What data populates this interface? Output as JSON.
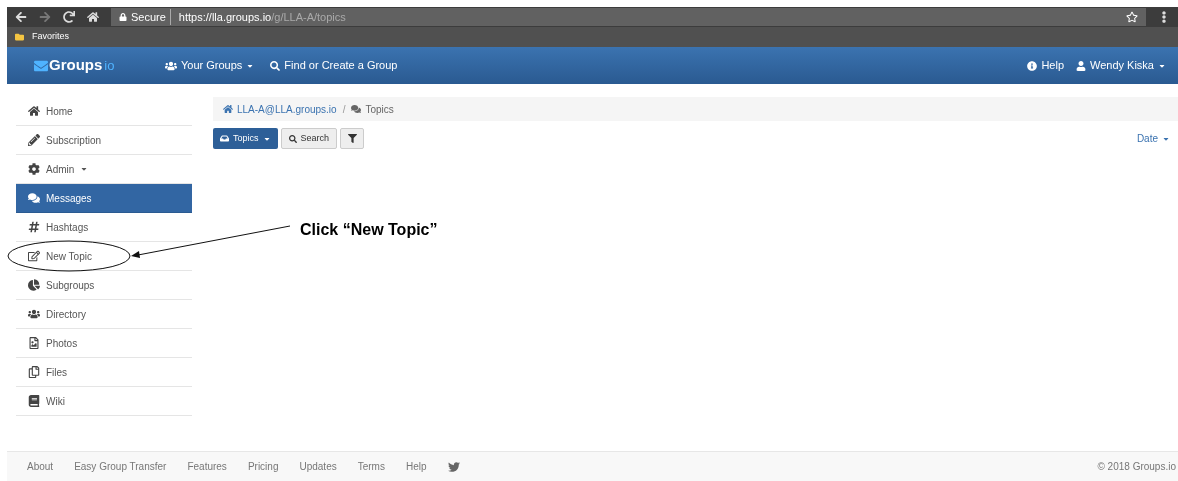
{
  "browser": {
    "secure_label": "Secure",
    "url_host": "https://lla.groups.io",
    "url_path": "/g/LLA-A/topics",
    "bookmarks": [
      "Favorites"
    ]
  },
  "navbar": {
    "logo": "Groups",
    "logo_suffix": "io",
    "left_items": [
      "Your Groups",
      "Find or Create a Group"
    ],
    "right_items": [
      "Help",
      "Wendy Kiska"
    ]
  },
  "sidebar": {
    "items": [
      {
        "label": "Home",
        "selected": false
      },
      {
        "label": "Subscription",
        "selected": false
      },
      {
        "label": "Admin",
        "selected": false
      },
      {
        "label": "Messages",
        "selected": true
      },
      {
        "label": "Hashtags",
        "selected": false
      },
      {
        "label": "New Topic",
        "selected": false
      },
      {
        "label": "Subgroups",
        "selected": false
      },
      {
        "label": "Directory",
        "selected": false
      },
      {
        "label": "Photos",
        "selected": false
      },
      {
        "label": "Files",
        "selected": false
      },
      {
        "label": "Wiki",
        "selected": false
      }
    ]
  },
  "breadcrumb": [
    "LLA-A@LLA.groups.io",
    "/",
    "Topics"
  ],
  "toolbar": {
    "topics_button": "Topics",
    "search_button": "Search",
    "sort": "Date"
  },
  "annotation": {
    "text": "Click “New Topic”"
  },
  "footer": {
    "links": [
      "About",
      "Easy Group Transfer",
      "Features",
      "Pricing",
      "Updates",
      "Terms",
      "Help"
    ],
    "copyright": "© 2018 Groups.io"
  }
}
